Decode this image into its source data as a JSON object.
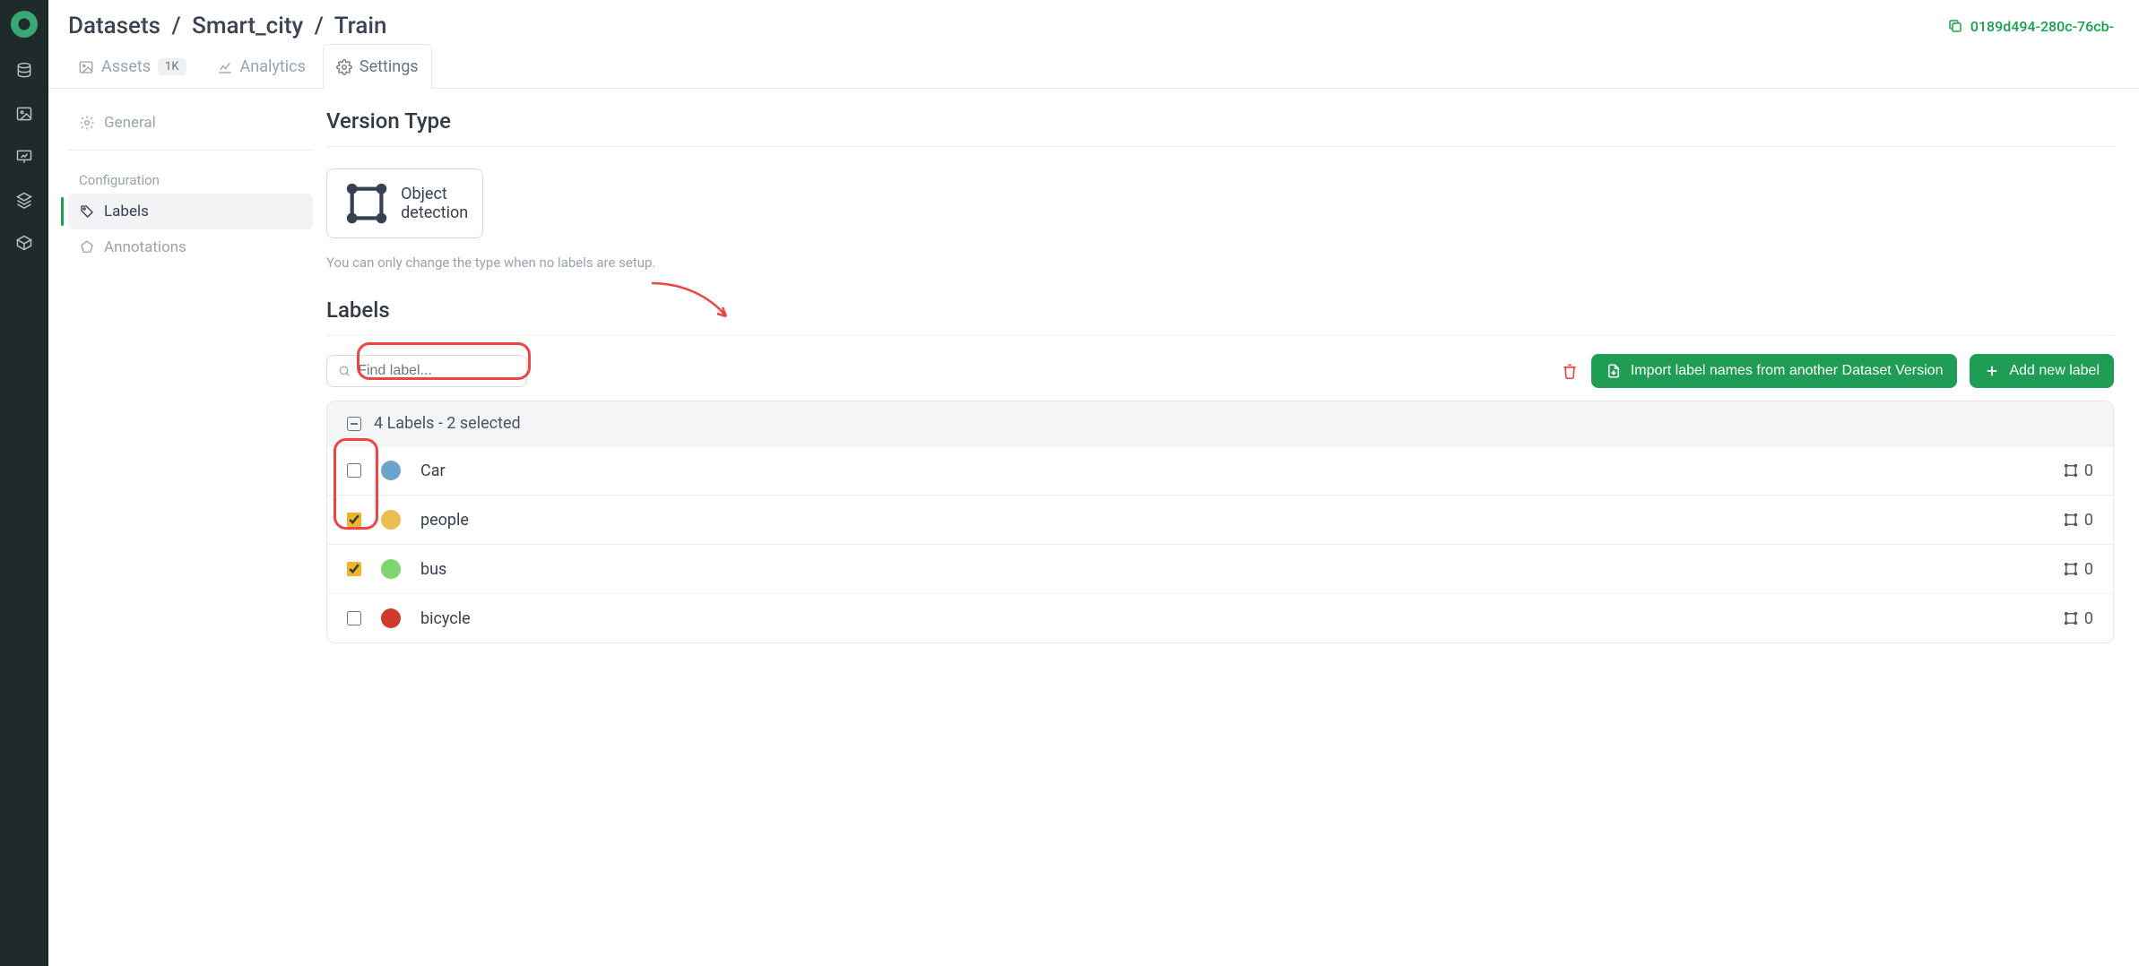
{
  "breadcrumb": {
    "root": "Datasets",
    "project": "Smart_city",
    "version": "Train"
  },
  "version_id": "0189d494-280c-76cb-",
  "tabs": {
    "assets": {
      "label": "Assets",
      "count": "1K"
    },
    "analytics": {
      "label": "Analytics"
    },
    "settings": {
      "label": "Settings"
    }
  },
  "side_menu": {
    "general": "General",
    "config_label": "Configuration",
    "labels": "Labels",
    "annotations": "Annotations"
  },
  "section": {
    "version_type_heading": "Version Type",
    "version_type_value": "Object detection",
    "version_type_hint": "You can only change the type when no labels are setup.",
    "labels_heading": "Labels"
  },
  "search": {
    "placeholder": "Find label..."
  },
  "buttons": {
    "import": "Import label names from another Dataset Version",
    "add": "Add new label"
  },
  "table": {
    "summary": "4 Labels - 2 selected",
    "rows": [
      {
        "name": "Car",
        "color": "#6aa3cc",
        "checked": false,
        "count": "0"
      },
      {
        "name": "people",
        "color": "#e9bd4e",
        "checked": true,
        "count": "0"
      },
      {
        "name": "bus",
        "color": "#7fd66f",
        "checked": true,
        "count": "0"
      },
      {
        "name": "bicycle",
        "color": "#cf3a2b",
        "checked": false,
        "count": "0"
      }
    ]
  }
}
